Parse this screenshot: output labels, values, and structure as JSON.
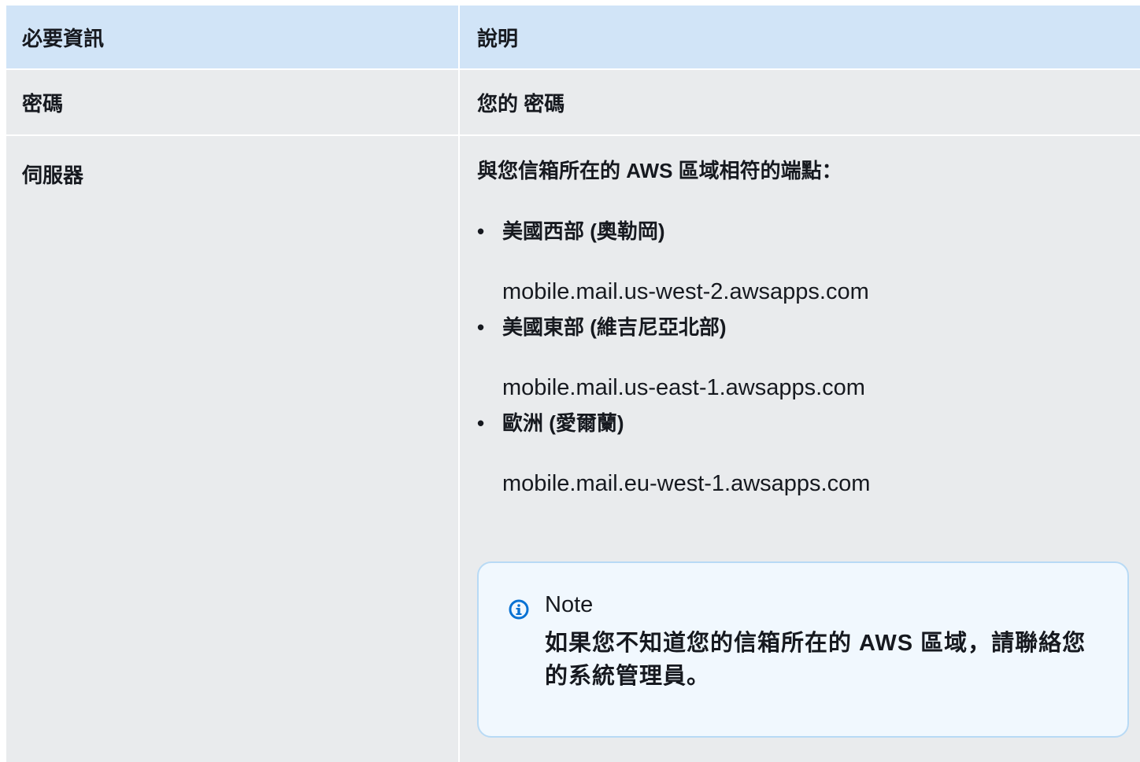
{
  "table": {
    "headers": [
      "必要資訊",
      "說明"
    ],
    "rows": [
      {
        "label": "密碼",
        "description": "您的 密碼"
      },
      {
        "label": "伺服器",
        "intro": "與您信箱所在的 AWS 區域相符的端點：",
        "regions": [
          {
            "name": "美國西部 (奧勒岡)",
            "endpoint": "mobile.mail.us-west-2.awsapps.com"
          },
          {
            "name": "美國東部 (維吉尼亞北部)",
            "endpoint": "mobile.mail.us-east-1.awsapps.com"
          },
          {
            "name": "歐洲 (愛爾蘭)",
            "endpoint": "mobile.mail.eu-west-1.awsapps.com"
          }
        ],
        "bullet": "•",
        "note": {
          "icon": "info-icon",
          "title": "Note",
          "text": "如果您不知道您的信箱所在的 AWS 區域，請聯絡您的系統管理員。"
        }
      }
    ]
  },
  "colors": {
    "header_bg": "#d1e4f7",
    "cell_bg": "#e9ebed",
    "note_bg": "#f1f8fe",
    "note_border": "#b8daf5",
    "info_icon": "#0972d3"
  }
}
